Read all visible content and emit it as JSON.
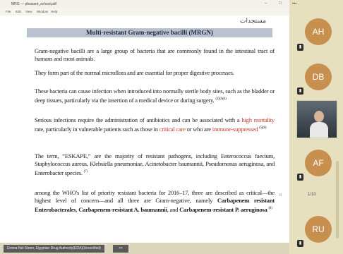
{
  "window": {
    "title": "MRG — pleasant_school.pdf",
    "controls": [
      "–",
      "□"
    ]
  },
  "menu": [
    "File",
    "Edit",
    "View",
    "Window",
    "Help"
  ],
  "doc": {
    "header_stamp": "مستجدات",
    "banner": "Multi-resistant Gram-negative bacilli (MRGN)",
    "p1": "Gram-negative bacilli are a large group of bacteria that are commonly found in the intestinal tract of humans and most animals.",
    "p2": "They form part of the normal microflora and are essential for proper digestive processes.",
    "p3": "These bacteria can cause infection when introduced into normally sterile body sites, such as the bladder or deep tissues, particularly via the insertion of a medical device or during surgery.",
    "p3_ref": "(2)(3)(4)",
    "p4_a": "Serious infections require the administration of antibiotics and can be associated with a",
    "p4_red1": "high mortality",
    "p4_b": "rate, particularly in vulnerable patients such as those in",
    "p4_red2": "critical care",
    "p4_c": "or who are",
    "p4_red3": "immune-suppressed",
    "p4_ref": "(5)(6)",
    "p5": "The term, “ESKAPE,” are the majority of resistant pathogens, including Enterococcus faecium, Staphylococcus aureus, Klebsiella pneumoniae, Acinetobacter baumannii, Pseudomonas aeruginosa, and Enterobacter species.",
    "p5_ref": "(7)",
    "p6_a": "among the WHO's list of priority resistant bacteria for 2016–17, three are described as critical—the highest level of concern—and all three are Gram-negative, namely",
    "p6_b1": "Carbapenem resistant Enterobacterales",
    "p6_c": ",",
    "p6_b2": "Carbapenem-resistant A. baumannii",
    "p6_d": ", and",
    "p6_b3": "Carbapenem-resistant P. aeruginosa",
    "p6_ref": "(8)",
    "page_marker": "8"
  },
  "status": {
    "presenter_label": "Emma Nel-Steen, Egyptian Drug Authority(EDA)(Unverified)",
    "more_label": "•••"
  },
  "participants": [
    {
      "initials": "AH",
      "color": "#c8904f"
    },
    {
      "initials": "DB",
      "color": "#c8904f"
    },
    {
      "initials": "AF",
      "color": "#c8904f"
    },
    {
      "initials": "RU",
      "color": "#c8904f"
    }
  ],
  "participant_count": "1/10",
  "panel_controls": "•••"
}
